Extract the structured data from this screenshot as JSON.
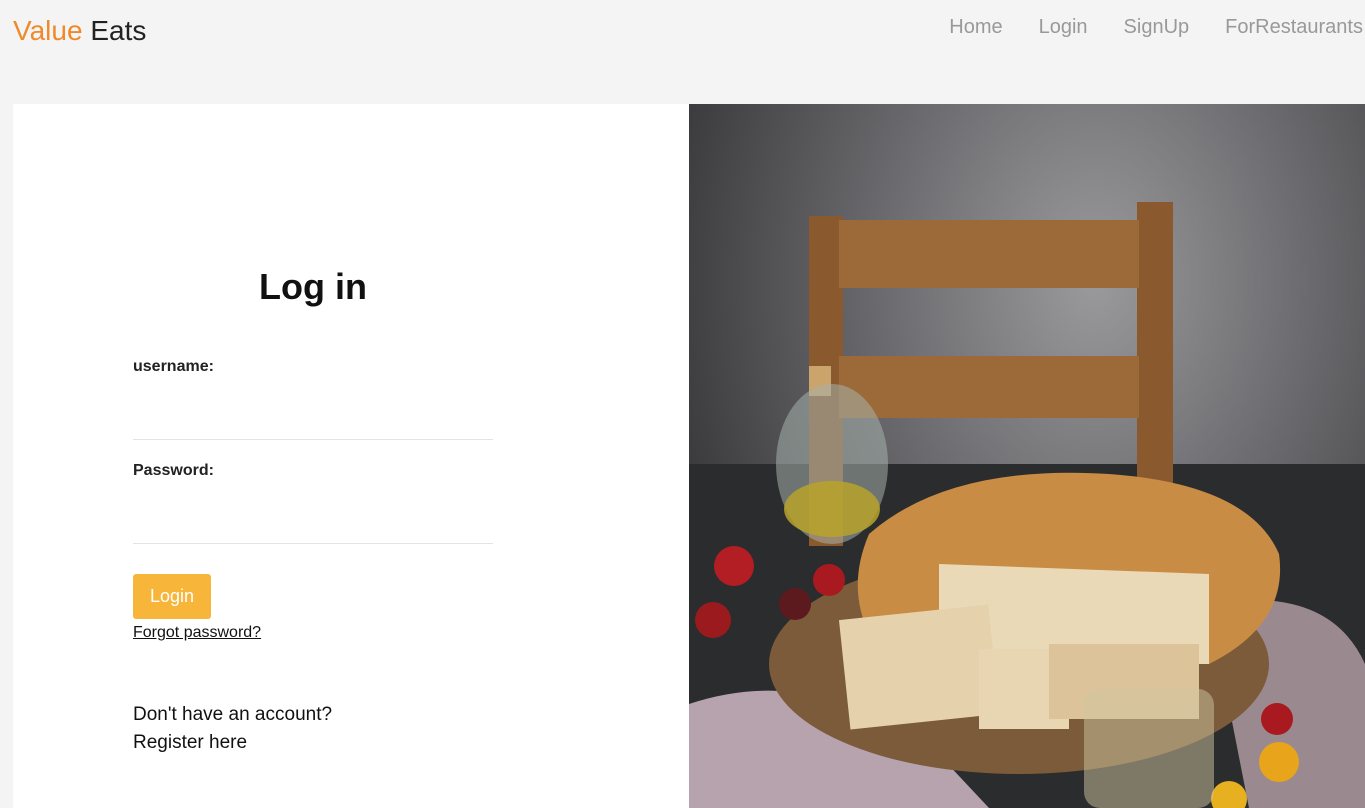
{
  "brand": {
    "part1": "Value",
    "part2": "Eats"
  },
  "nav": {
    "home": "Home",
    "login": "Login",
    "signup": "SignUp",
    "restaurants": "ForRestaurants"
  },
  "form": {
    "title": "Log in",
    "username_label": "username:",
    "password_label": "Password:",
    "login_button": "Login",
    "forgot_password": "Forgot password?",
    "no_account": "Don't have an account?",
    "register": "Register here"
  },
  "colors": {
    "brand_accent": "#ee8a2c",
    "button": "#f7b63a",
    "background": "#f4f4f4"
  },
  "image": {
    "icon": "focaccia-photo"
  }
}
